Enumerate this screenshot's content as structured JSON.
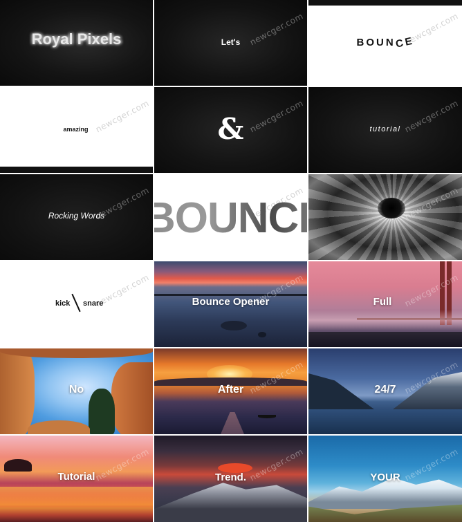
{
  "watermark": "newcger.com",
  "tiles": {
    "t1": {
      "caption": "Royal Pixels"
    },
    "t2": {
      "caption": "Let's"
    },
    "t3": {
      "caption_main": "BOUN",
      "caption_tail": "CE"
    },
    "t4": {
      "caption": "amazing"
    },
    "t5": {
      "caption": "&"
    },
    "t6": {
      "caption": "tutorial"
    },
    "t7": {
      "caption": "Rocking Words"
    },
    "t8": {
      "caption": "BOUNCE"
    },
    "t9": {
      "caption": ""
    },
    "t10": {
      "left": "kick",
      "right": "snare"
    },
    "t11": {
      "caption": "Bounce Opener"
    },
    "t12": {
      "caption": "Full"
    },
    "t13": {
      "caption": "No"
    },
    "t14": {
      "caption": "After"
    },
    "t15": {
      "caption": "24/7"
    },
    "t16": {
      "caption": "Tutorial"
    },
    "t17": {
      "caption": "Trend."
    },
    "t18": {
      "caption": "YOUR"
    }
  }
}
